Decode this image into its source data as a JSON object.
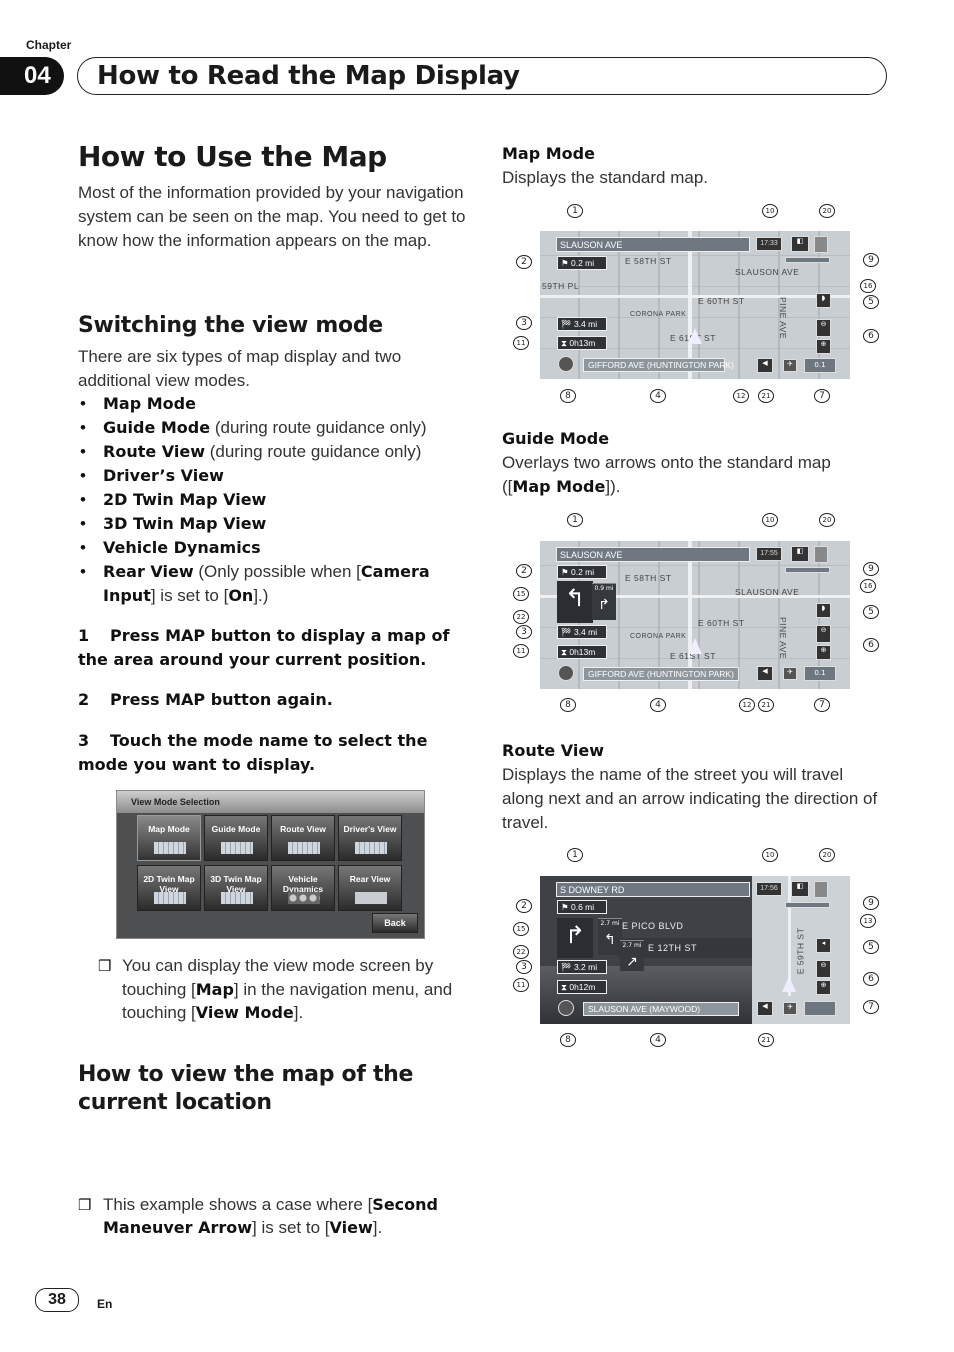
{
  "header": {
    "chapter_label": "Chapter",
    "chapter_number": "04",
    "chapter_title": "How to Read the Map Display"
  },
  "left": {
    "title": "How to Use the Map",
    "intro": "Most of the information provided by your navigation system can be seen on the map. You need to get to know how the information appears on the map.",
    "switching": {
      "heading": "Switching the view mode",
      "text": "There are six types of map display and two additional view modes.",
      "bullets": [
        {
          "bold": "Map Mode",
          "rest": ""
        },
        {
          "bold": "Guide Mode",
          "rest": " (during route guidance only)"
        },
        {
          "bold": "Route View",
          "rest": " (during route guidance only)"
        },
        {
          "bold": "Driver’s View",
          "rest": ""
        },
        {
          "bold": "2D Twin Map View",
          "rest": ""
        },
        {
          "bold": "3D Twin Map View",
          "rest": ""
        },
        {
          "bold": "Vehicle Dynamics",
          "rest": ""
        },
        {
          "bold": "Rear View",
          "rest": " (Only possible when [",
          "bold2": "Camera Input",
          "rest2": "] is set to [",
          "bold3": "On",
          "rest3": "].)"
        }
      ],
      "steps": [
        {
          "num": "1",
          "text": "Press MAP button to display a map of the area around your current position."
        },
        {
          "num": "2",
          "text": "Press MAP button again."
        },
        {
          "num": "3",
          "text": "Touch the mode name to select the mode you want to display."
        }
      ],
      "screen": {
        "title": "View Mode Selection",
        "buttons": [
          "Map Mode",
          "Guide Mode",
          "Route View",
          "Driver's View",
          "2D Twin Map View",
          "3D Twin Map View",
          "Vehicle Dynamics",
          "Rear View"
        ],
        "back_label": "Back"
      },
      "note": {
        "p1": "You can display the view mode screen by touching [",
        "b1": "Map",
        "p2": "] in the navigation menu, and touching [",
        "b2": "View Mode",
        "p3": "]."
      }
    },
    "current_location": {
      "heading": "How to view the map of the current location",
      "note": {
        "p1": "This example shows a case where [",
        "b1": "Second Maneuver Arrow",
        "p2": "] is set to [",
        "b2": "View",
        "p3": "]."
      }
    }
  },
  "right": {
    "map_mode": {
      "heading": "Map Mode",
      "text": "Displays the standard map.",
      "screen": {
        "street": "SLAUSON AVE",
        "time": "17:33",
        "next_dist": "0.2 mi",
        "dest_dist": "3.4 mi",
        "eta": "0h13m",
        "current_street": "GIFFORD AVE (HUNTINGTON PARK)",
        "map_labels": [
          "E 58TH ST",
          "SLAUSON AVE",
          "59TH PL",
          "E 60TH ST",
          "CORONA PARK",
          "E 61ST ST",
          "PINE AVE"
        ]
      },
      "callouts": [
        "1",
        "10",
        "20",
        "2",
        "9",
        "16",
        "5",
        "3",
        "11",
        "6",
        "8",
        "4",
        "12",
        "21",
        "7"
      ]
    },
    "guide_mode": {
      "heading": "Guide Mode",
      "text_pre": "Overlays two arrows onto the standard map ([",
      "text_bold": "Map Mode",
      "text_post": "]).",
      "screen": {
        "street": "SLAUSON AVE",
        "time": "17:55",
        "next_dist": "0.2 mi",
        "second_dist": "0.9 mi",
        "dest_dist": "3.4 mi",
        "eta": "0h13m",
        "current_street": "GIFFORD AVE (HUNTINGTON PARK)",
        "map_labels": [
          "E 58TH ST",
          "SLAUSON AVE",
          "E 60TH ST",
          "CORONA PARK",
          "E 61ST ST",
          "PINE AVE"
        ]
      },
      "callouts": [
        "1",
        "10",
        "20",
        "2",
        "9",
        "15",
        "16",
        "22",
        "5",
        "3",
        "11",
        "6",
        "8",
        "4",
        "12",
        "21",
        "7"
      ]
    },
    "route_view": {
      "heading": "Route View",
      "text": "Displays the name of the street you will travel along next and an arrow indicating the direction of travel.",
      "screen": {
        "street": "S DOWNEY RD",
        "time": "17:56",
        "next_dist": "0.6 mi",
        "route1_dist": "2.7 mi",
        "route1_name": "E PICO BLVD",
        "route2_dist": "2.7 mi",
        "route2_name": "E 12TH ST",
        "dest_dist": "3.2 mi",
        "eta": "0h12m",
        "current_street": "SLAUSON AVE (MAYWOOD)",
        "map_labels": [
          "E 59TH ST"
        ]
      },
      "callouts": [
        "1",
        "10",
        "20",
        "2",
        "9",
        "15",
        "13",
        "22",
        "5",
        "3",
        "6",
        "11",
        "7",
        "8",
        "4",
        "21"
      ]
    }
  },
  "footer": {
    "page_number": "38",
    "language": "En"
  }
}
